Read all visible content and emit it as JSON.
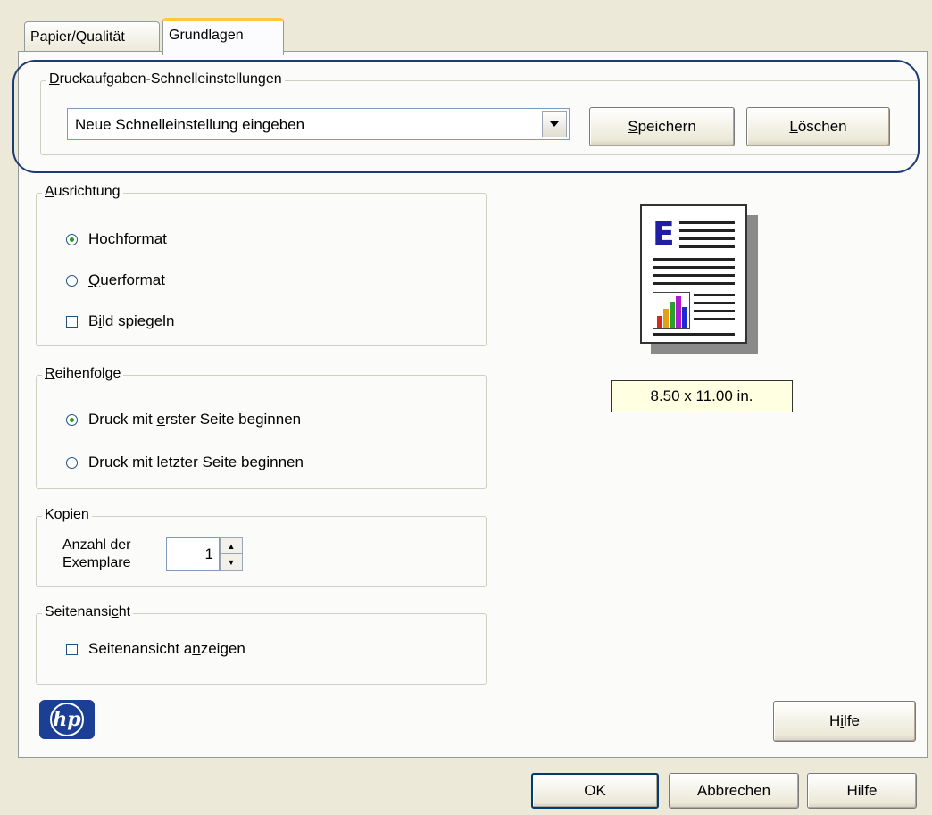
{
  "tabs": [
    {
      "label": "Papier/Qualität",
      "active": false
    },
    {
      "label": "Grundlagen",
      "active": true
    }
  ],
  "quick_settings": {
    "legend_u": "D",
    "legend_rest": "ruckaufgaben-Schnelleinstellungen",
    "combo_value": "Neue Schnelleinstellung eingeben",
    "save_u": "S",
    "save_rest": "peichern",
    "delete_u": "L",
    "delete_rest": "öschen"
  },
  "orientation": {
    "legend_u": "A",
    "legend_rest": "usrichtung",
    "portrait_a": "Hoch",
    "portrait_u": "f",
    "portrait_b": "ormat",
    "portrait_selected": true,
    "landscape_u": "Q",
    "landscape_rest": "uerformat",
    "landscape_selected": false,
    "mirror_a": "B",
    "mirror_u": "i",
    "mirror_b": "ld spiegeln",
    "mirror_checked": false
  },
  "order": {
    "legend_u": "R",
    "legend_rest": "eihenfolge",
    "first_a": "Druck mit ",
    "first_u": "e",
    "first_b": "rster Seite beginnen",
    "first_selected": true,
    "last": "Druck mit letzter Seite beginnen",
    "last_selected": false
  },
  "copies": {
    "legend_u": "K",
    "legend_rest": "opien",
    "label_line1": "Anzahl der",
    "label_line2": "Exemplare",
    "value": "1"
  },
  "preview": {
    "legend_a": "Seitenansi",
    "legend_u": "c",
    "legend_b": "ht",
    "show_a": "Seitenansicht a",
    "show_u": "n",
    "show_b": "zeigen",
    "checked": false
  },
  "page_size": "8.50 x 11.00 in.",
  "help_panel": {
    "a": "H",
    "u": "i",
    "b": "lfe"
  },
  "footer": {
    "ok": "OK",
    "cancel": "Abbrechen",
    "help": "Hilfe"
  },
  "logo": "hp",
  "icons": {
    "document": "document-preview-icon",
    "dropdown": "chevron-down-icon",
    "spin": "spin-up-down-icon"
  },
  "colors": {
    "tab_accent": "#ffc73c",
    "ring": "#1d3a73",
    "tooltip_bg": "#ffffe1",
    "hp_blue": "#1b3f95"
  }
}
